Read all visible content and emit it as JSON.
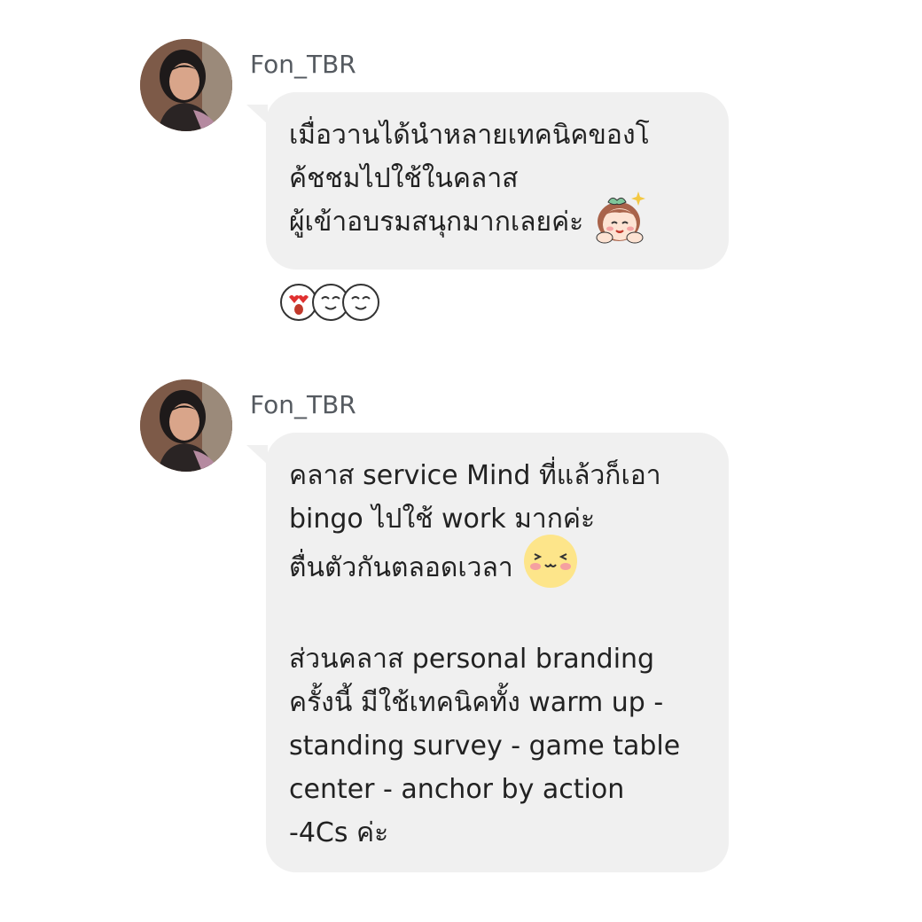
{
  "messages": [
    {
      "sender": "Fon_TBR",
      "lines": [
        "เมื่อวานได้นำหลายเทคนิคของโ",
        "ค้ชชมไปใช้ในคลาส",
        "ผู้เข้าอบรมสนุกมากเลยค่ะ"
      ],
      "inline_icon": "girl-sticker-icon",
      "reactions": [
        "heart-eyes-icon",
        "smiling-face-icon",
        "smiling-face-icon"
      ]
    },
    {
      "sender": "Fon_TBR",
      "lines": [
        "คลาส service Mind ที่แล้วก็เอา",
        "bingo ไปใช้ work มากค่ะ",
        "ตื่นตัวกันตลอดเวลา",
        "",
        "ส่วนคลาส personal branding",
        "ครั้งนี้ มีใช้เทคนิคทั้ง warm up -",
        "standing survey - game table",
        "center - anchor by action",
        "-4Cs ค่ะ"
      ],
      "inline_icon": "blushing-face-icon"
    }
  ],
  "colors": {
    "bubble": "#f0f0f0",
    "text": "#222222",
    "sender": "#555a60",
    "emoji_yellow": "#fde58a"
  }
}
